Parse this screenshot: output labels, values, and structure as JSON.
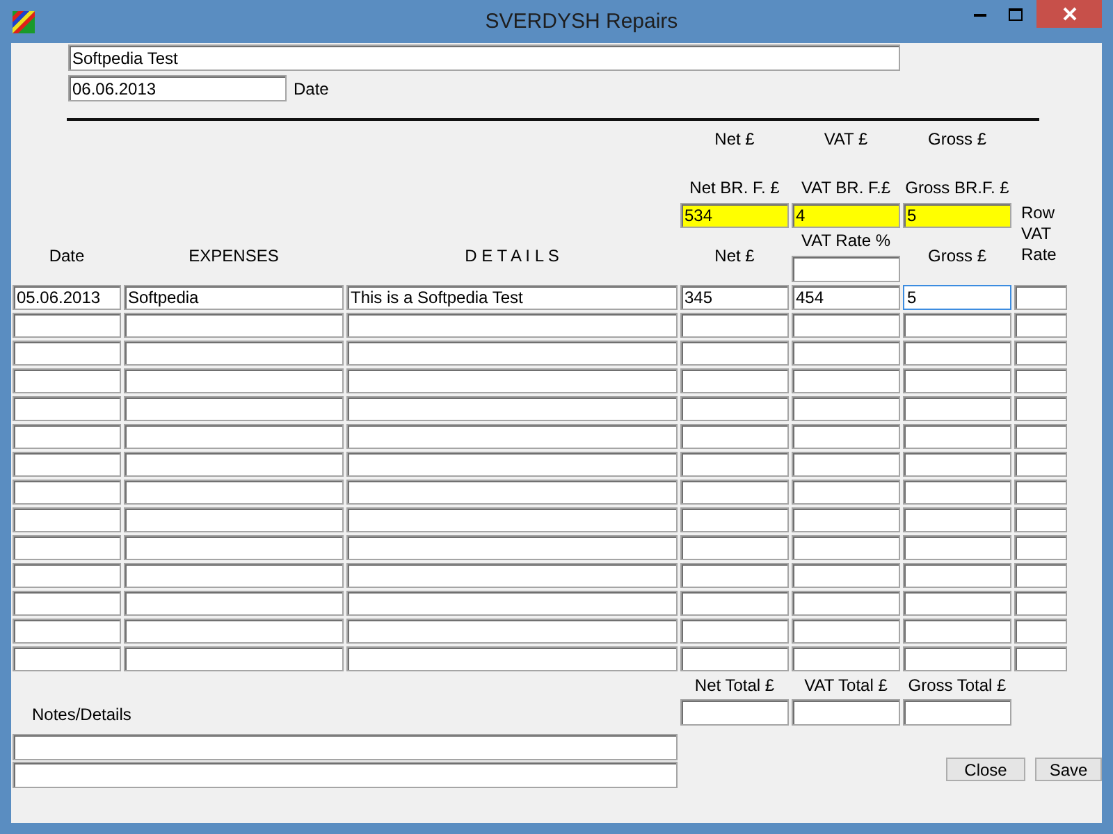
{
  "window": {
    "title": "SVERDYSH Repairs"
  },
  "name_field": {
    "value": "Softpedia Test"
  },
  "date_field": {
    "value": "06.06.2013",
    "label": "Date"
  },
  "summary_headers": [
    "Net £",
    "VAT £",
    "Gross £"
  ],
  "brought_forward": [
    {
      "label": "Net BR. F. £",
      "value": "534"
    },
    {
      "label": "VAT BR. F.£",
      "value": "4"
    },
    {
      "label": "Gross BR.F. £",
      "value": "5"
    }
  ],
  "row_vat_rate_label": "Row VAT Rate",
  "vat_rate": {
    "label": "VAT Rate %"
  },
  "table": {
    "columns": [
      "Date",
      "EXPENSES",
      "D E T A I L S",
      "Net £",
      "Gross £"
    ],
    "rows": [
      {
        "date": "05.06.2013",
        "expense": "Softpedia",
        "details": "This is a Softpedia Test",
        "net": "345",
        "vat": "454",
        "gross": "5",
        "focused": true
      },
      {
        "focused": false
      },
      {
        "focused": false
      },
      {
        "focused": false
      },
      {
        "focused": false
      },
      {
        "focused": false
      },
      {
        "focused": false
      },
      {
        "focused": false
      },
      {
        "focused": false
      },
      {
        "focused": false
      },
      {
        "focused": false
      },
      {
        "focused": false
      },
      {
        "focused": false
      },
      {
        "focused": false
      }
    ]
  },
  "totals": [
    {
      "label": "Net Total £"
    },
    {
      "label": "VAT Total £"
    },
    {
      "label": "Gross Total £"
    }
  ],
  "notes": {
    "label": "Notes/Details"
  },
  "buttons": [
    "Close",
    "Save"
  ]
}
